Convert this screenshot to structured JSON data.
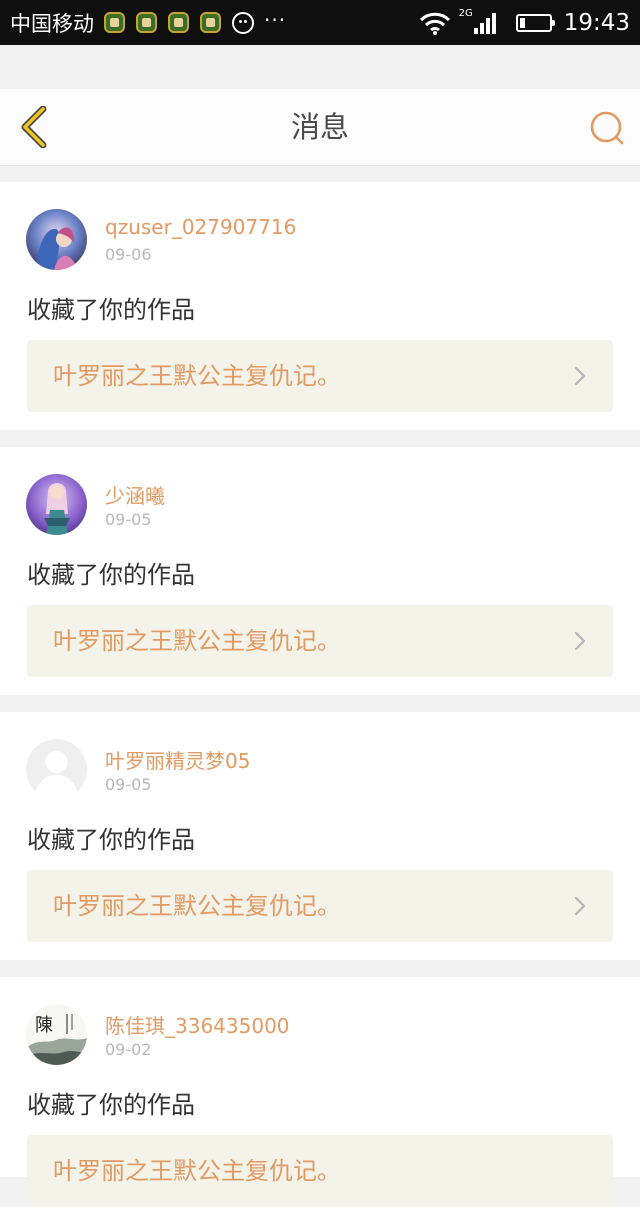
{
  "status_bar": {
    "carrier": "中国移动",
    "network": "2G",
    "time": "19:43",
    "more": "···",
    "icons": [
      "app-notification-icon",
      "app-notification-icon",
      "app-notification-icon",
      "app-notification-icon",
      "smiley-icon",
      "wifi-icon",
      "signal-icon",
      "battery-icon"
    ]
  },
  "header": {
    "title": "消息",
    "back_icon": "chevron-left-icon",
    "search_icon": "search-icon"
  },
  "colors": {
    "accent": "#e29a63",
    "back_icon": "#f0c419",
    "link_bg": "#f4f3e9",
    "date": "#b8b8b8"
  },
  "messages": [
    {
      "username": "qzuser_027907716",
      "date": "09-06",
      "action": "收藏了你的作品",
      "work_title": "叶罗丽之王默公主复仇记。",
      "avatar": "fantasy-girl-avatar"
    },
    {
      "username": "少涵曦",
      "date": "09-05",
      "action": "收藏了你的作品",
      "work_title": "叶罗丽之王默公主复仇记。",
      "avatar": "doll-avatar"
    },
    {
      "username": "叶罗丽精灵梦05",
      "date": "09-05",
      "action": "收藏了你的作品",
      "work_title": "叶罗丽之王默公主复仇记。",
      "avatar": "default-user-avatar"
    },
    {
      "username": "陈佳琪_336435000",
      "date": "09-02",
      "action": "收藏了你的作品",
      "work_title": "叶罗丽之王默公主复仇记。",
      "avatar": "ink-painting-avatar",
      "avatar_text": "陳"
    }
  ]
}
